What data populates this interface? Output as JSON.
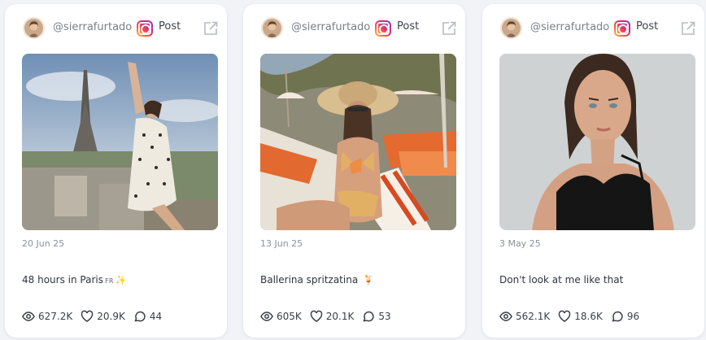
{
  "cards": [
    {
      "handle": "@sierrafurtado",
      "post_label": "Post",
      "date": "20 Jun 25",
      "caption": "48 hours in Paris",
      "caption_flag": "FR",
      "caption_emoji": "✨",
      "views": "627.2K",
      "likes": "20.9K",
      "comments": "44"
    },
    {
      "handle": "@sierrafurtado",
      "post_label": "Post",
      "date": "13 Jun 25",
      "caption": "Ballerina spritzatina",
      "caption_emoji": "🍹",
      "views": "605K",
      "likes": "20.1K",
      "comments": "53"
    },
    {
      "handle": "@sierrafurtado",
      "post_label": "Post",
      "date": "3 May 25",
      "caption": "Don't look at me like that",
      "views": "562.1K",
      "likes": "18.6K",
      "comments": "96"
    }
  ],
  "icons": {
    "platform": "instagram-icon",
    "open": "external-link-icon",
    "views": "eye-icon",
    "likes": "heart-icon",
    "comments": "comment-icon"
  },
  "colors": {
    "background": "#f1f3f7",
    "card": "#ffffff",
    "muted_text": "#8c919a"
  }
}
